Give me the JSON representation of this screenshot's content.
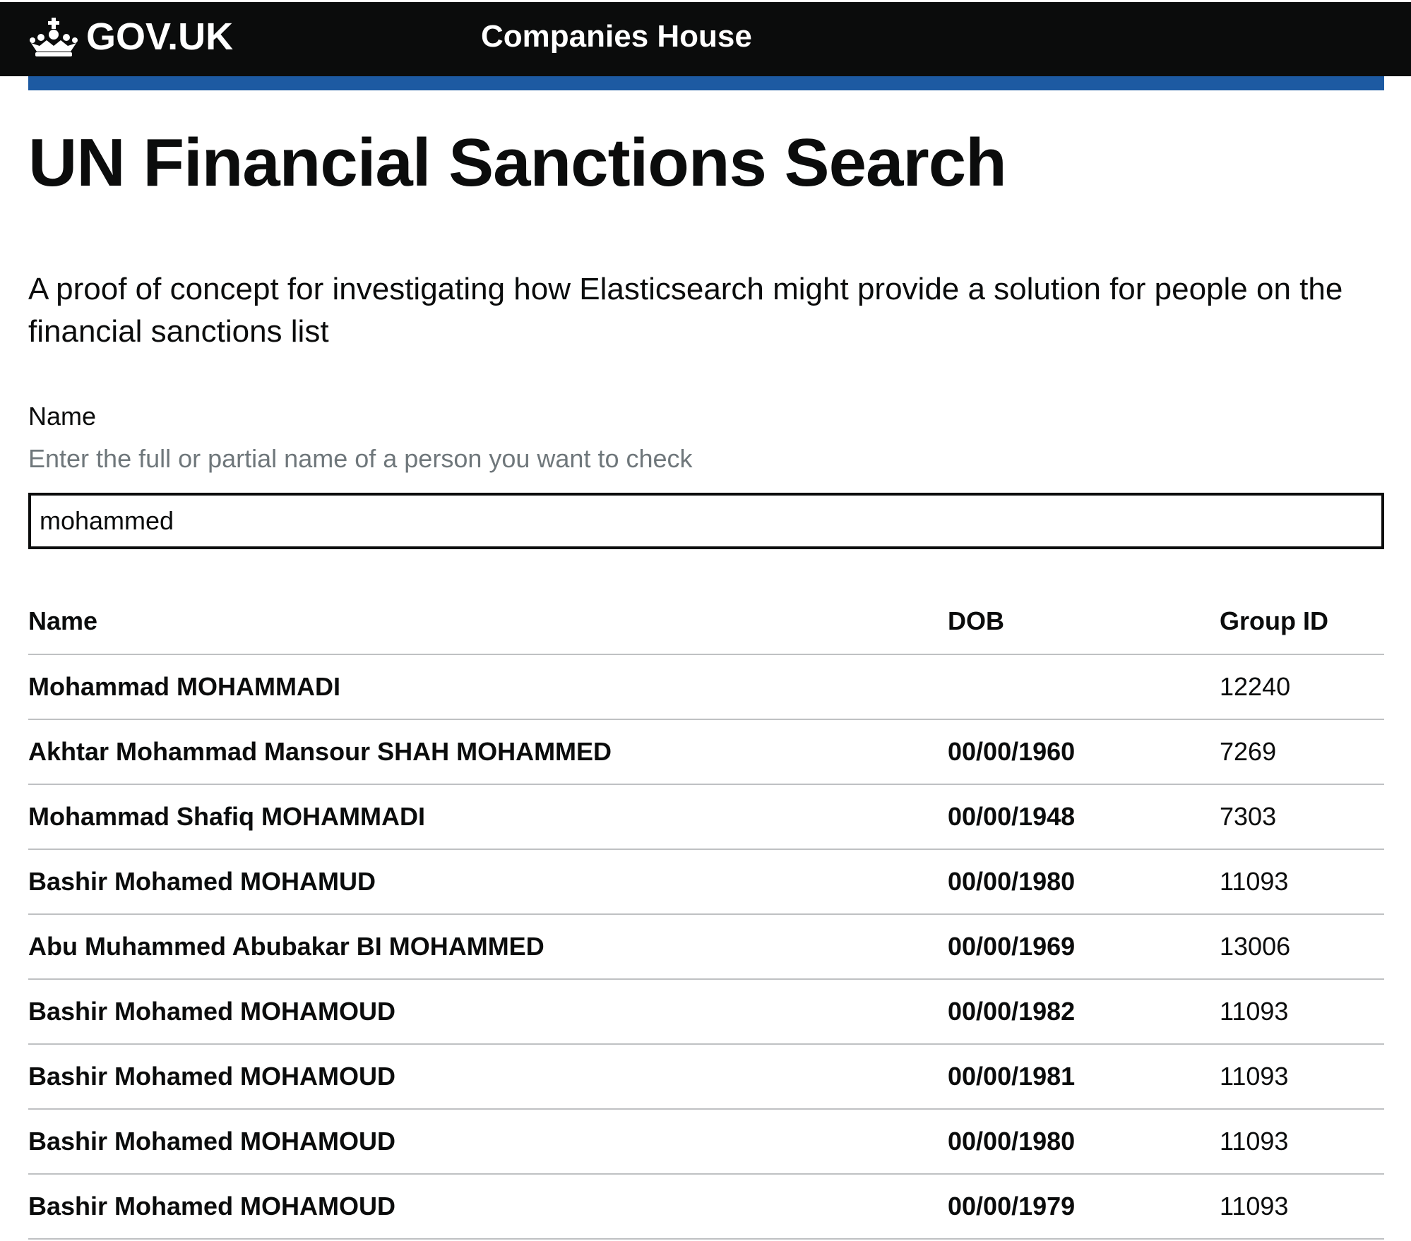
{
  "header": {
    "brand": "GOV.UK",
    "service_name": "Companies House"
  },
  "page": {
    "title": "UN Financial Sanctions Search",
    "lead": "A proof of concept for investigating how Elasticsearch might provide a solution for people on the financial sanctions list"
  },
  "search": {
    "label": "Name",
    "hint": "Enter the full or partial name of a person you want to check",
    "value": "mohammed"
  },
  "results": {
    "columns": [
      "Name",
      "DOB",
      "Group ID"
    ],
    "rows": [
      {
        "name": "Mohammad MOHAMMADI",
        "dob": "",
        "group_id": "12240"
      },
      {
        "name": "Akhtar Mohammad Mansour SHAH MOHAMMED",
        "dob": "00/00/1960",
        "group_id": "7269"
      },
      {
        "name": "Mohammad Shafiq MOHAMMADI",
        "dob": "00/00/1948",
        "group_id": "7303"
      },
      {
        "name": "Bashir Mohamed MOHAMUD",
        "dob": "00/00/1980",
        "group_id": "11093"
      },
      {
        "name": "Abu Muhammed Abubakar BI MOHAMMED",
        "dob": "00/00/1969",
        "group_id": "13006"
      },
      {
        "name": "Bashir Mohamed MOHAMOUD",
        "dob": "00/00/1982",
        "group_id": "11093"
      },
      {
        "name": "Bashir Mohamed MOHAMOUD",
        "dob": "00/00/1981",
        "group_id": "11093"
      },
      {
        "name": "Bashir Mohamed MOHAMOUD",
        "dob": "00/00/1980",
        "group_id": "11093"
      },
      {
        "name": "Bashir Mohamed MOHAMOUD",
        "dob": "00/00/1979",
        "group_id": "11093"
      }
    ]
  },
  "icons": {
    "brand_icon": "crown-icon"
  },
  "colors": {
    "header_bg": "#0b0c0c",
    "accent_rule": "#1d5aa2",
    "hint_text": "#6f777b",
    "row_divider": "#bfc1c3"
  }
}
